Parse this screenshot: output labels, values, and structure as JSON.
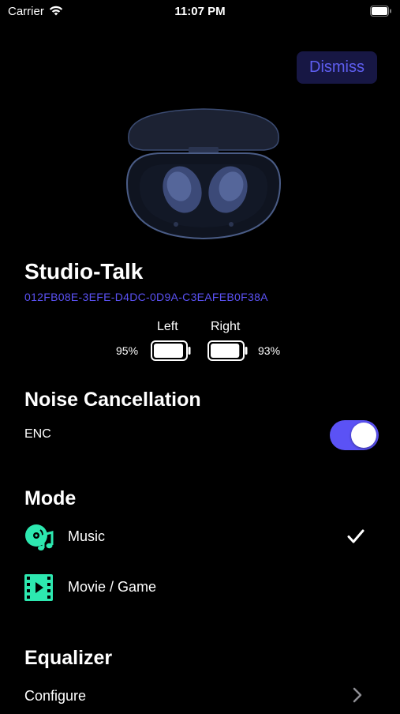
{
  "status_bar": {
    "carrier": "Carrier",
    "time": "11:07 PM"
  },
  "header": {
    "dismiss_label": "Dismiss"
  },
  "device": {
    "name": "Studio-Talk",
    "id": "012FB08E-3EFE-D4DC-0D9A-C3EAFEB0F38A",
    "left": {
      "label": "Left",
      "battery": "95%",
      "level": 0.95
    },
    "right": {
      "label": "Right",
      "battery": "93%",
      "level": 0.93
    }
  },
  "noise": {
    "title": "Noise Cancellation",
    "enc_label": "ENC",
    "enc_on": true
  },
  "mode": {
    "title": "Mode",
    "items": [
      {
        "label": "Music",
        "selected": true,
        "icon": "music-disc-icon"
      },
      {
        "label": "Movie / Game",
        "selected": false,
        "icon": "film-icon"
      }
    ]
  },
  "equalizer": {
    "title": "Equalizer",
    "configure_label": "Configure"
  },
  "colors": {
    "accent": "#5b52f5",
    "icon_green": "#2de8b0",
    "dismiss_bg": "#171744"
  }
}
